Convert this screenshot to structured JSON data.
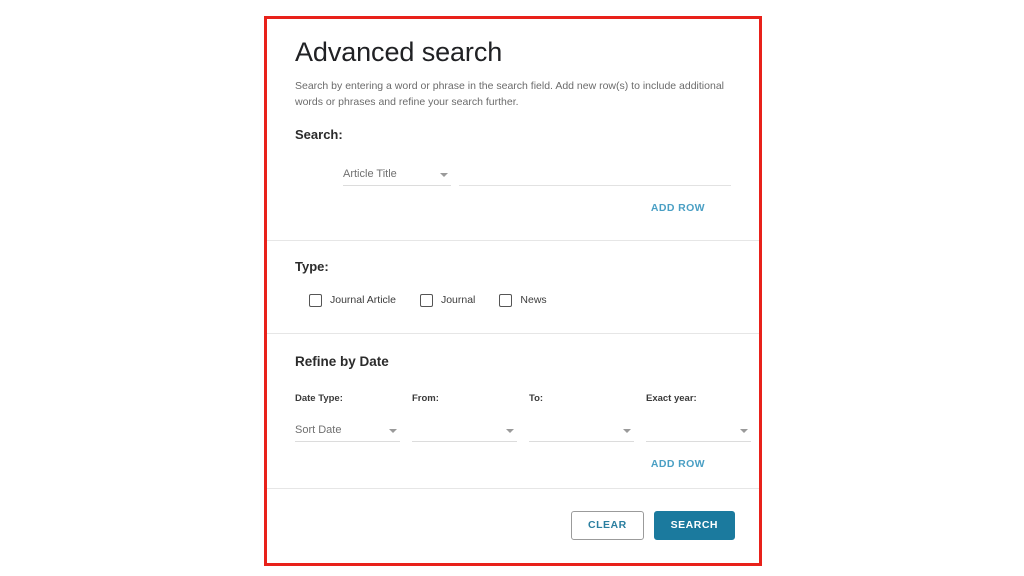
{
  "form": {
    "title": "Advanced search",
    "description": "Search by entering a word or phrase in the search field. Add new row(s) to include additional words or phrases and refine your search further."
  },
  "search_section": {
    "label": "Search:",
    "field_type_value": "Article Title",
    "query_value": "",
    "query_placeholder": "",
    "add_row_label": "ADD ROW"
  },
  "type_section": {
    "label": "Type:",
    "options": [
      {
        "label": "Journal Article",
        "checked": false
      },
      {
        "label": "Journal",
        "checked": false
      },
      {
        "label": "News",
        "checked": false
      }
    ]
  },
  "date_section": {
    "heading": "Refine by Date",
    "columns": [
      {
        "label": "Date Type:",
        "value": "Sort Date"
      },
      {
        "label": "From:",
        "value": ""
      },
      {
        "label": "To:",
        "value": ""
      },
      {
        "label": "Exact year:",
        "value": ""
      }
    ],
    "add_row_label": "ADD ROW"
  },
  "footer": {
    "clear_label": "CLEAR",
    "search_label": "SEARCH"
  },
  "colors": {
    "highlight_frame": "#e8211a",
    "primary_button": "#1b7a9e",
    "link": "#4a9fc4",
    "divider": "#e6e6e6"
  }
}
